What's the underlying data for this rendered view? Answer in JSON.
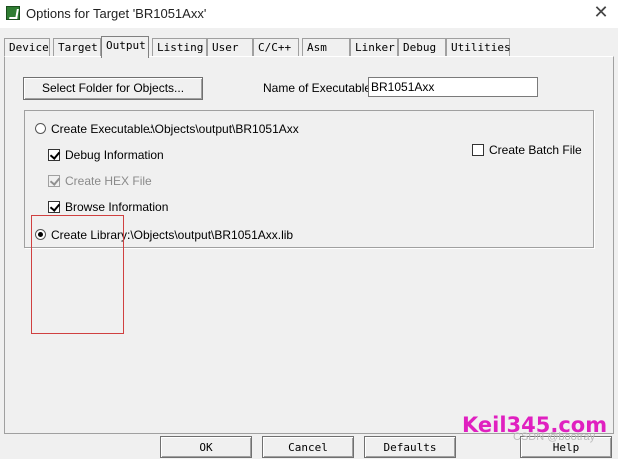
{
  "window": {
    "title": "Options for Target 'BR1051Axx'"
  },
  "tabs": [
    "Device",
    "Target",
    "Output",
    "Listing",
    "User",
    "C/C++",
    "Asm",
    "Linker",
    "Debug",
    "Utilities"
  ],
  "output": {
    "select_folder_label": "Select Folder for Objects...",
    "name_exec_label": "Name of Executable:",
    "name_exec_value": "BR1051Axx",
    "create_exec_label": "Create Executable:",
    "create_exec_path": ".\\Objects\\output\\BR1051Axx",
    "debug_info_label": "Debug Information",
    "debug_info_checked": true,
    "create_hex_label": "Create HEX File",
    "create_hex_checked": true,
    "browse_info_label": "Browse Information",
    "browse_info_checked": true,
    "create_batch_label": "Create Batch File",
    "create_batch_checked": false,
    "create_library_label": "Create Library:",
    "create_library_path": ".\\Objects\\output\\BR1051Axx.lib",
    "selected_radio": "create_library"
  },
  "buttons": {
    "ok": "OK",
    "cancel": "Cancel",
    "defaults": "Defaults",
    "help": "Help"
  },
  "watermark": {
    "site": "Keil345.com",
    "csdn": "CSDN @bootray"
  }
}
